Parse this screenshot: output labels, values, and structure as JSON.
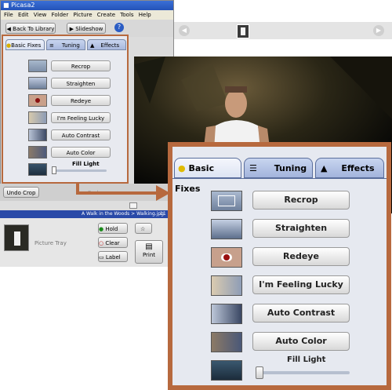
{
  "window": {
    "title": "Picasa2",
    "menu": [
      "File",
      "Edit",
      "View",
      "Folder",
      "Picture",
      "Create",
      "Tools",
      "Help"
    ]
  },
  "toolbar": {
    "back_label": "Back To Library",
    "slideshow_label": "Slideshow",
    "help_label": "?"
  },
  "small_panel": {
    "tabs": [
      "Basic Fixes",
      "Tuning",
      "Effects"
    ],
    "buttons": [
      "Recrop",
      "Straighten",
      "Redeye",
      "I'm Feeling Lucky",
      "Auto Contrast",
      "Auto Color"
    ],
    "fill_light_label": "Fill Light"
  },
  "bottom": {
    "undo_label": "Undo Crop",
    "redo_label": "Redo",
    "path_text": "A Walk in the Woods > Walking.jpg",
    "tray_label": "Picture Tray",
    "hold_label": "Hold",
    "clear_label": "Clear",
    "label_label": "Label",
    "print_label": "Print"
  },
  "zoom_panel": {
    "tabs": [
      "Basic Fixes",
      "Tuning",
      "Effects"
    ],
    "buttons": [
      "Recrop",
      "Straighten",
      "Redeye",
      "I'm Feeling Lucky",
      "Auto Contrast",
      "Auto Color"
    ],
    "fill_light_label": "Fill Light",
    "fill_light_value": 0
  },
  "colors": {
    "callout": "#b7693e",
    "tab_blue": "#a8b8de",
    "title_blue": "#2453b8"
  }
}
